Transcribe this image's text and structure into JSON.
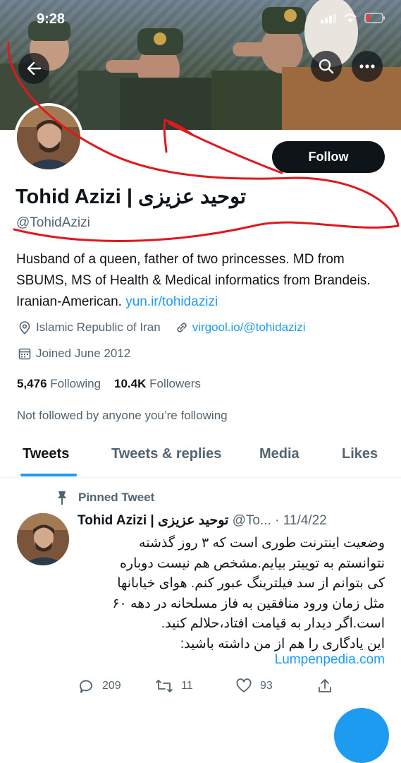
{
  "status": {
    "time": "9:28"
  },
  "header": {
    "back_icon": "arrow-left-icon",
    "search_icon": "search-icon",
    "more_icon": "more-icon"
  },
  "profile": {
    "follow_label": "Follow",
    "name": "Tohid Azizi | توحید عزیزی",
    "handle": "@TohidAzizi",
    "bio_text": "Husband of a queen, father of two princesses. MD from SBUMS, MS of Health & Medical informatics from Brandeis. Iranian-American. ",
    "bio_link": "yun.ir/tohidazizi",
    "location": "Islamic Republic of Iran",
    "website": "virgool.io/@tohidazizi",
    "joined": "Joined June 2012",
    "following_count": "5,476",
    "following_label": "Following",
    "followers_count": "10.4K",
    "followers_label": "Followers",
    "not_followed": "Not followed by anyone you’re following"
  },
  "tabs": [
    {
      "label": "Tweets"
    },
    {
      "label": "Tweets & replies"
    },
    {
      "label": "Media"
    },
    {
      "label": "Likes"
    }
  ],
  "tweet": {
    "pinned_label": "Pinned Tweet",
    "name": "Tohid Azizi | توحید عزیزی",
    "handle": "@To...",
    "date": "· 11/4/22",
    "lines": [
      "وضعیت اینترنت طوری است که ۳ روز گذشته",
      "نتوانستم به توییتر بیایم.مشخص هم نیست دوباره",
      "کی بتوانم از سد فیلترینگ عبور کنم. هوای خیابانها",
      "مثل زمان ورود منافقین به فاز مسلحانه در دهه ۶۰",
      "است.اگر دیدار به قیامت افتاد،حلالم کنید.",
      "این یادگاری را هم از من داشته باشید:"
    ],
    "link": "Lumpenpedia.com",
    "replies": "209",
    "retweets": "11",
    "likes": "93"
  },
  "colors": {
    "accent": "#1d9bf0",
    "text": "#0f1419",
    "secondary": "#536471",
    "annotation": "#e0191e"
  }
}
